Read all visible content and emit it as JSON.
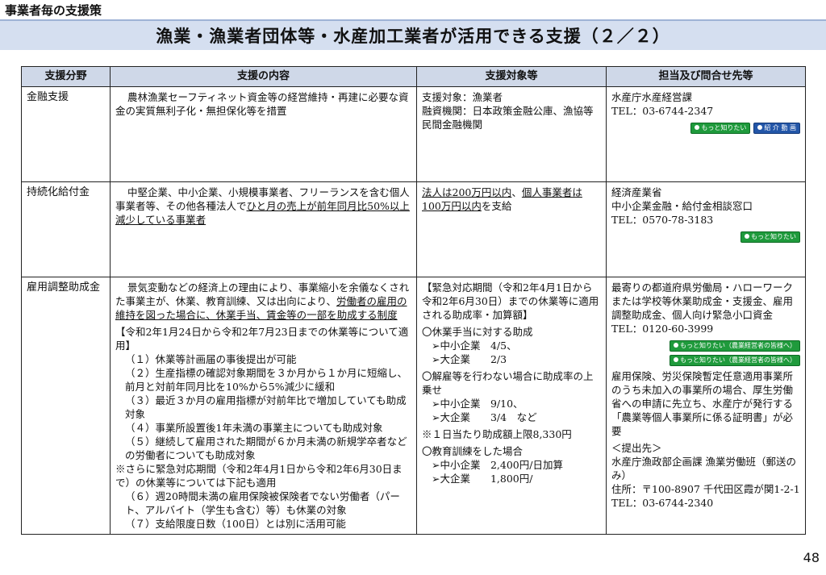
{
  "section_label": "事業者毎の支援策",
  "title": "漁業・漁業者団体等・水産加工業者が活用できる支援（２／２）",
  "headers": [
    "支援分野",
    "支援の内容",
    "支援対象等",
    "担当及び問合せ先等"
  ],
  "rows": [
    {
      "field": "金融支援",
      "content": "農林漁業セーフティネット資金等の経営維持・再建に必要な資金の実質無利子化・無担保化等を措置",
      "target": {
        "line1": "支援対象：漁業者",
        "line2": "融資機関：日本政策金融公庫、漁協等民間金融機関"
      },
      "contact": {
        "org": "水産庁水産経営課",
        "tel": "TEL：03-6744-2347",
        "btn_more": "もっと知りたい",
        "btn_video": "紹 介 動 画"
      }
    },
    {
      "field": "持続化給付金",
      "content_plain": "中堅企業、中小企業、小規模事業者、フリーランスを含む個人事業者等、その他各種法人で",
      "content_u": "ひと月の売上が前年同月比50%以上減少している事業者",
      "target": {
        "u1": "法人は200万円以内",
        "sep": "、",
        "u2": "個人事業者は100万円以内",
        "tail": "を支給"
      },
      "contact": {
        "org": "経済産業省",
        "dept": "中小企業金融・給付金相談窓口",
        "tel": "TEL：0570-78-3183",
        "btn_more": "もっと知りたい"
      }
    },
    {
      "field": "雇用調整助成金",
      "content": {
        "intro_plain": "景気変動などの経済上の理由により、事業縮小を余儀なくされた事業主が、休業、教育訓練、又は出向により、",
        "intro_u": "労働者の雇用の維持を図った場合に、休業手当、賃金等の一部を助成する制度",
        "period": "【令和2年1月24日から令和2年7月23日までの休業等について適用】",
        "items": [
          "（１）休業等計画届の事後提出が可能",
          "（２）生産指標の確認対象期間を３か月から１か月に短縮し、前月と対前年同月比を10%から5%減少に緩和",
          "（３）最近３か月の雇用指標が対前年比で増加していても助成対象",
          "（４）事業所設置後1年未満の事業主についても助成対象",
          "（５）継続して雇用された期間が６か月未満の新規学卒者などの労働者についても助成対象"
        ],
        "note": "※さらに緊急対応期間（令和2年4月1日から令和2年6月30日まで）の休業等については下記も適用",
        "items2": [
          "（６）週20時間未満の雇用保険被保険者でない労働者（パート、アルバイト（学生も含む）等）も休業の対象",
          "（７）支給限度日数（100日）とは別に活用可能"
        ]
      },
      "target": {
        "period": "【緊急対応期間（令和2年4月1日から令和2年6月30日）までの休業等に適用される助成率・加算額】",
        "g1_title": "〇休業手当に対する助成",
        "g1_a": "➢中小企業　4/5、",
        "g1_b": "➢大企業　　2/3",
        "g2_title": "〇解雇等を行わない場合に助成率の上乗せ",
        "g2_a": "➢中小企業　9/10、",
        "g2_b": "➢大企業　　3/4　など",
        "limit": "※１日当たり助成額上限8,330円",
        "g3_title": "〇教育訓練をした場合",
        "g3_a": "➢中小企業　2,400円/日加算",
        "g3_b": "➢大企業　　1,800円/"
      },
      "contact": {
        "org": "最寄りの都道府県労働局・ハローワークまたは学校等休業助成金・支援金、雇用調整助成金、個人向け緊急小口資金",
        "tel": "TEL：0120-60-3999",
        "btn1": "もっと知りたい（農業経営者の皆様へ）",
        "btn2": "もっと知りたい（農業経営者の皆様へ）",
        "insurance": "雇用保険、労災保険暫定任意適用事業所のうち未加入の事業所の場合、厚生労働省への申請に先立ち、水産庁が発行する「農業等個人事業所に係る証明書」が必要",
        "submit_label": "＜提出先＞",
        "submit_to": "水産庁漁政部企画課 漁業労働班（郵送のみ）",
        "address": "住所：〒100-8907 千代田区霞が関1-2-1",
        "submit_tel": "TEL：03-6744-2340"
      }
    }
  ],
  "page_number": "48"
}
